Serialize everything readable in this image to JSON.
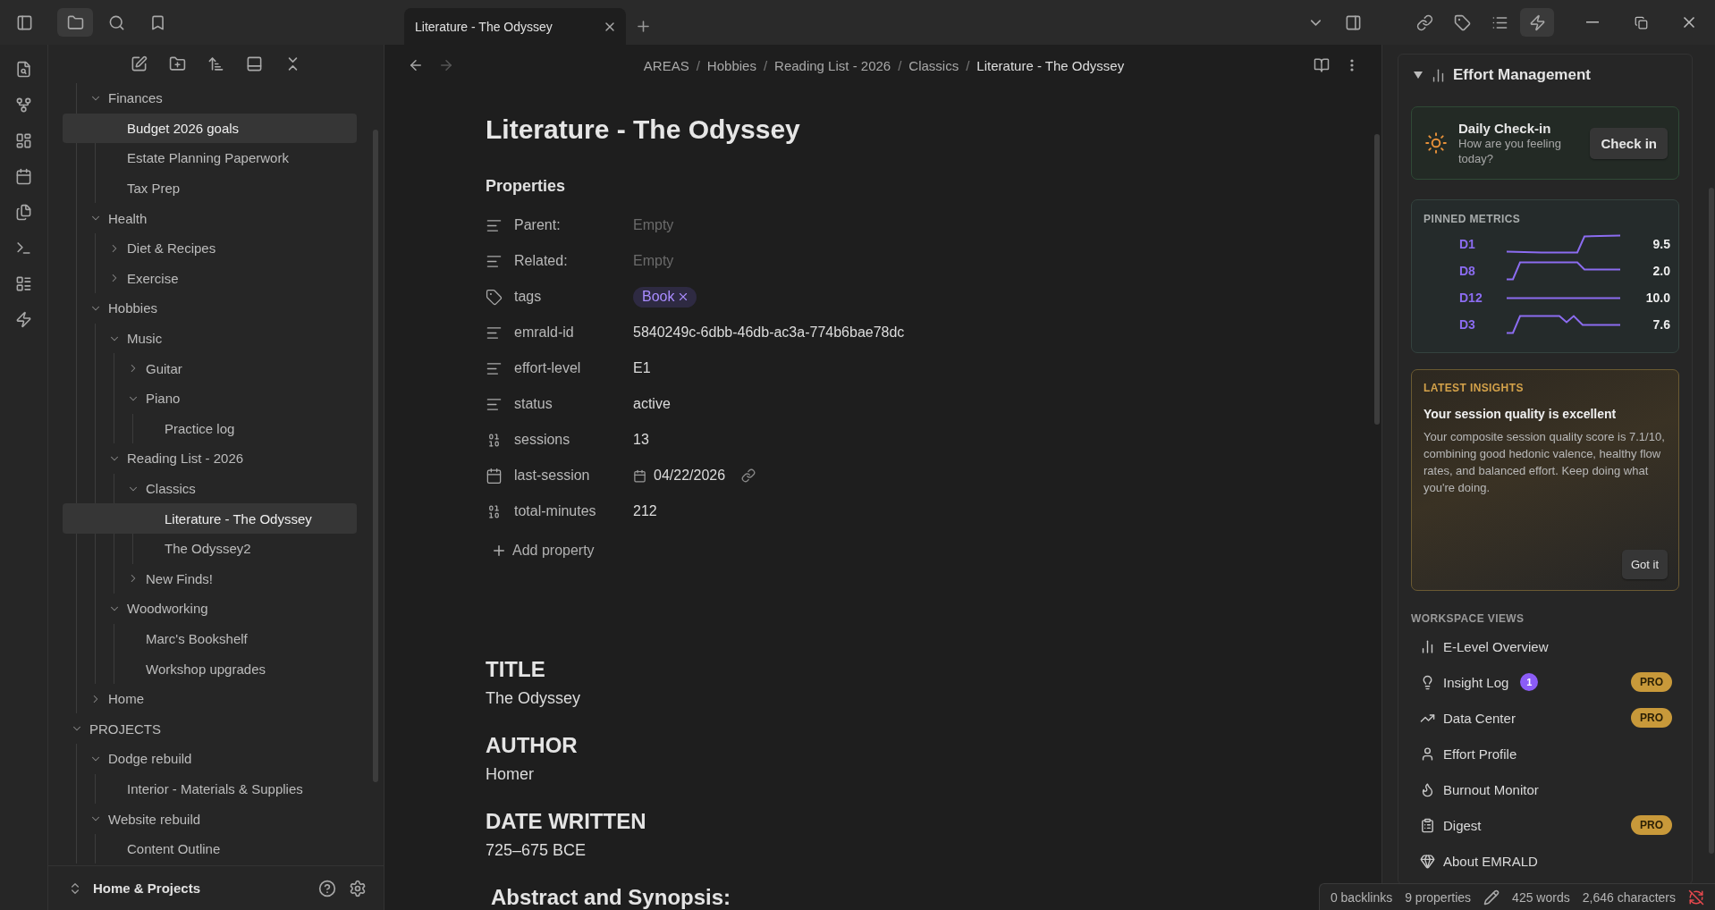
{
  "top_bar": {
    "sidebar_views": [
      {
        "selected": true
      },
      {
        "selected": false
      },
      {
        "selected": false
      }
    ],
    "tabs": [
      {
        "title": "Literature - The Odyssey",
        "selected": true
      }
    ],
    "right_tools": [
      {
        "selected": false
      },
      {
        "selected": false
      },
      {
        "selected": false
      },
      {
        "selected": false
      },
      {
        "selected": false
      },
      {
        "selected": true
      }
    ]
  },
  "sidebar": {
    "tree_continued": [
      {
        "label": "Finances",
        "kind": "folder",
        "expanded": true,
        "selected": false,
        "children": [
          {
            "label": "Budget 2026 goals",
            "kind": "file",
            "selected": true
          },
          {
            "label": "Estate Planning Paperwork",
            "kind": "file",
            "selected": false
          },
          {
            "label": "Tax Prep",
            "kind": "file",
            "selected": false
          }
        ]
      },
      {
        "label": "Health",
        "kind": "folder",
        "expanded": true,
        "selected": false,
        "children": [
          {
            "label": "Diet & Recipes",
            "kind": "folder",
            "expanded": false,
            "selected": false
          },
          {
            "label": "Exercise",
            "kind": "folder",
            "expanded": false,
            "selected": false
          }
        ]
      },
      {
        "label": "Hobbies",
        "kind": "folder",
        "expanded": true,
        "selected": false,
        "children": [
          {
            "label": "Music",
            "kind": "folder",
            "expanded": true,
            "selected": false,
            "children": [
              {
                "label": "Guitar",
                "kind": "folder",
                "expanded": false,
                "selected": false
              },
              {
                "label": "Piano",
                "kind": "folder",
                "expanded": true,
                "selected": false,
                "children": [
                  {
                    "label": "Practice log",
                    "kind": "file",
                    "selected": false
                  }
                ]
              }
            ]
          },
          {
            "label": "Reading List - 2026",
            "kind": "folder",
            "expanded": true,
            "selected": false,
            "children": [
              {
                "label": "Classics",
                "kind": "folder",
                "expanded": true,
                "selected": false,
                "children": [
                  {
                    "label": "Literature - The Odyssey",
                    "kind": "file",
                    "selected": true
                  },
                  {
                    "label": "The Odyssey2",
                    "kind": "file",
                    "selected": false
                  }
                ]
              },
              {
                "label": "New Finds!",
                "kind": "folder",
                "expanded": false,
                "selected": false
              }
            ]
          },
          {
            "label": "Woodworking",
            "kind": "folder",
            "expanded": true,
            "selected": false,
            "children": [
              {
                "label": "Marc's Bookshelf",
                "kind": "file",
                "selected": false
              },
              {
                "label": "Workshop upgrades",
                "kind": "file",
                "selected": false
              }
            ]
          }
        ]
      },
      {
        "label": "Home",
        "kind": "folder",
        "expanded": false,
        "selected": false
      }
    ],
    "tree": [
      {
        "label": "PROJECTS",
        "kind": "folder",
        "expanded": true,
        "selected": false,
        "children": [
          {
            "label": "Dodge rebuild",
            "kind": "folder",
            "expanded": true,
            "selected": false,
            "children": [
              {
                "label": "Interior - Materials & Supplies",
                "kind": "file",
                "selected": false
              }
            ]
          },
          {
            "label": "Website rebuild",
            "kind": "folder",
            "expanded": true,
            "selected": false,
            "children": [
              {
                "label": "Content Outline",
                "kind": "file",
                "selected": false
              }
            ]
          }
        ]
      }
    ],
    "vault": "Home & Projects"
  },
  "editor": {
    "breadcrumb": [
      "AREAS",
      "Hobbies",
      "Reading List - 2026",
      "Classics",
      "Literature - The Odyssey"
    ],
    "breadcrumb_separator": "/",
    "title": "Literature - The Odyssey",
    "properties_heading": "Properties",
    "properties": [
      {
        "label": "Parent:",
        "kind": "text",
        "placeholder": "Empty"
      },
      {
        "label": "Related:",
        "kind": "text",
        "placeholder": "Empty"
      },
      {
        "label": "tags",
        "kind": "tags",
        "tags": [
          "Book"
        ]
      },
      {
        "label": "emrald-id",
        "kind": "text",
        "value": "5840249c-6dbb-46db-ac3a-774b6bae78dc"
      },
      {
        "label": "effort-level",
        "kind": "text",
        "value": "E1"
      },
      {
        "label": "status",
        "kind": "text",
        "value": "active"
      },
      {
        "label": "sessions",
        "kind": "number",
        "value": "13"
      },
      {
        "label": "last-session",
        "kind": "date",
        "value": "04/22/2026"
      },
      {
        "label": "total-minutes",
        "kind": "number",
        "value": "212"
      }
    ],
    "add_property": "Add property",
    "sections": [
      {
        "heading": "TITLE",
        "text": "The Odyssey"
      },
      {
        "heading": "AUTHOR",
        "text": "Homer"
      },
      {
        "heading": "DATE WRITTEN",
        "text": "725–675 BCE"
      },
      {
        "heading": "Abstract and Synopsis:"
      }
    ]
  },
  "effort_panel": {
    "title": "Effort Management",
    "expanded": true,
    "checkin": {
      "title": "Daily Check-in",
      "subtitle": "How are you feeling today?",
      "button": "Check in"
    },
    "pinned": {
      "heading": "PINNED METRICS",
      "metrics": [
        {
          "label": "D1",
          "value": "9.5"
        },
        {
          "label": "D8",
          "value": "2.0"
        },
        {
          "label": "D12",
          "value": "10.0"
        },
        {
          "label": "D3",
          "value": "7.6"
        }
      ]
    },
    "insights": {
      "heading": "LATEST INSIGHTS",
      "title": "Your session quality is excellent",
      "body": "Your composite session quality score is 7.1/10, combining good hedonic valence, healthy flow rates, and balanced effort. Keep doing what you're doing.",
      "button": "Got it"
    },
    "views_heading": "WORKSPACE VIEWS",
    "views": [
      {
        "label": "E-Level Overview",
        "pro": false
      },
      {
        "label": "Insight Log",
        "count": "1",
        "pro": true,
        "pro_label": "PRO"
      },
      {
        "label": "Data Center",
        "pro": true,
        "pro_label": "PRO"
      },
      {
        "label": "Effort Profile",
        "pro": false
      },
      {
        "label": "Burnout Monitor",
        "pro": false
      },
      {
        "label": "Digest",
        "pro": true,
        "pro_label": "PRO"
      },
      {
        "label": "About EMRALD",
        "pro": false
      }
    ]
  },
  "status_bar": {
    "backlinks": "0 backlinks",
    "properties": "9 properties",
    "words": "425 words",
    "characters": "2,646 characters",
    "sync_off": true
  }
}
